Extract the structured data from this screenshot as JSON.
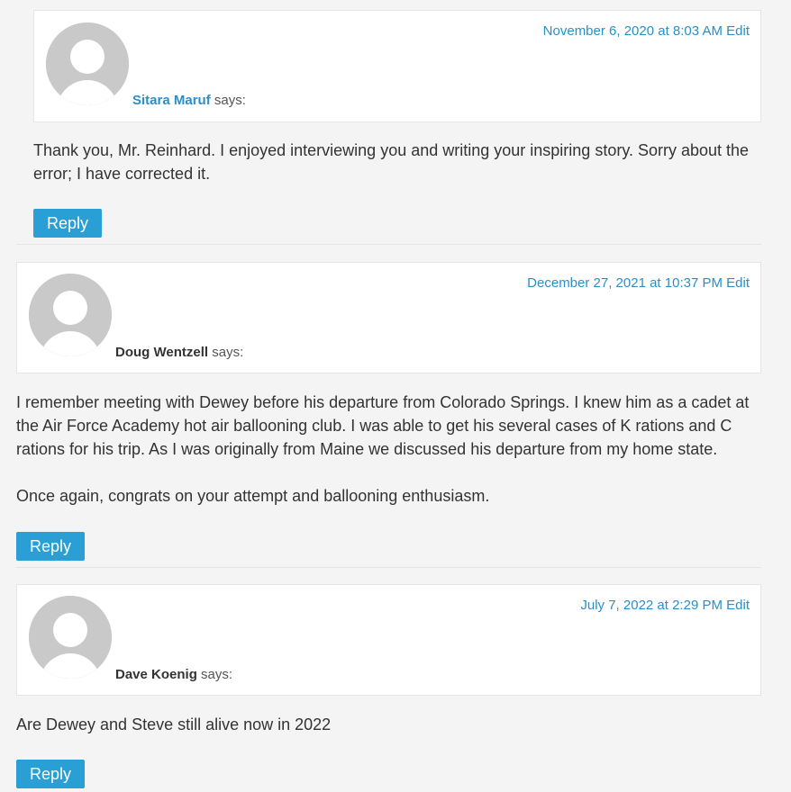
{
  "comments": [
    {
      "author": "Sitara Maruf",
      "says": "says:",
      "date": "November 6, 2020 at 8:03 AM",
      "edit": "Edit",
      "paragraphs": [
        "Thank you, Mr. Reinhard. I enjoyed interviewing you and writing your inspiring story. Sorry about the error; I have corrected it."
      ],
      "reply": "Reply"
    },
    {
      "author": "Doug Wentzell",
      "says": "says:",
      "date": "December 27, 2021 at 10:37 PM",
      "edit": "Edit",
      "paragraphs": [
        "I remember meeting with Dewey before his departure from Colorado Springs. I knew him as a cadet at the Air Force Academy hot air ballooning club. I was able to get his several cases of K rations and C rations for his trip. As I was originally from Maine we discussed his departure from my home state.",
        "Once again, congrats on your attempt and ballooning enthusiasm."
      ],
      "reply": "Reply"
    },
    {
      "author": "Dave Koenig",
      "says": "says:",
      "date": "July 7, 2022 at 2:29 PM",
      "edit": "Edit",
      "paragraphs": [
        "Are Dewey and Steve still alive now in 2022"
      ],
      "reply": "Reply"
    }
  ],
  "colors": {
    "link": "#2a8fc7",
    "button": "#2a9fd6",
    "background": "#f4f4f4"
  }
}
